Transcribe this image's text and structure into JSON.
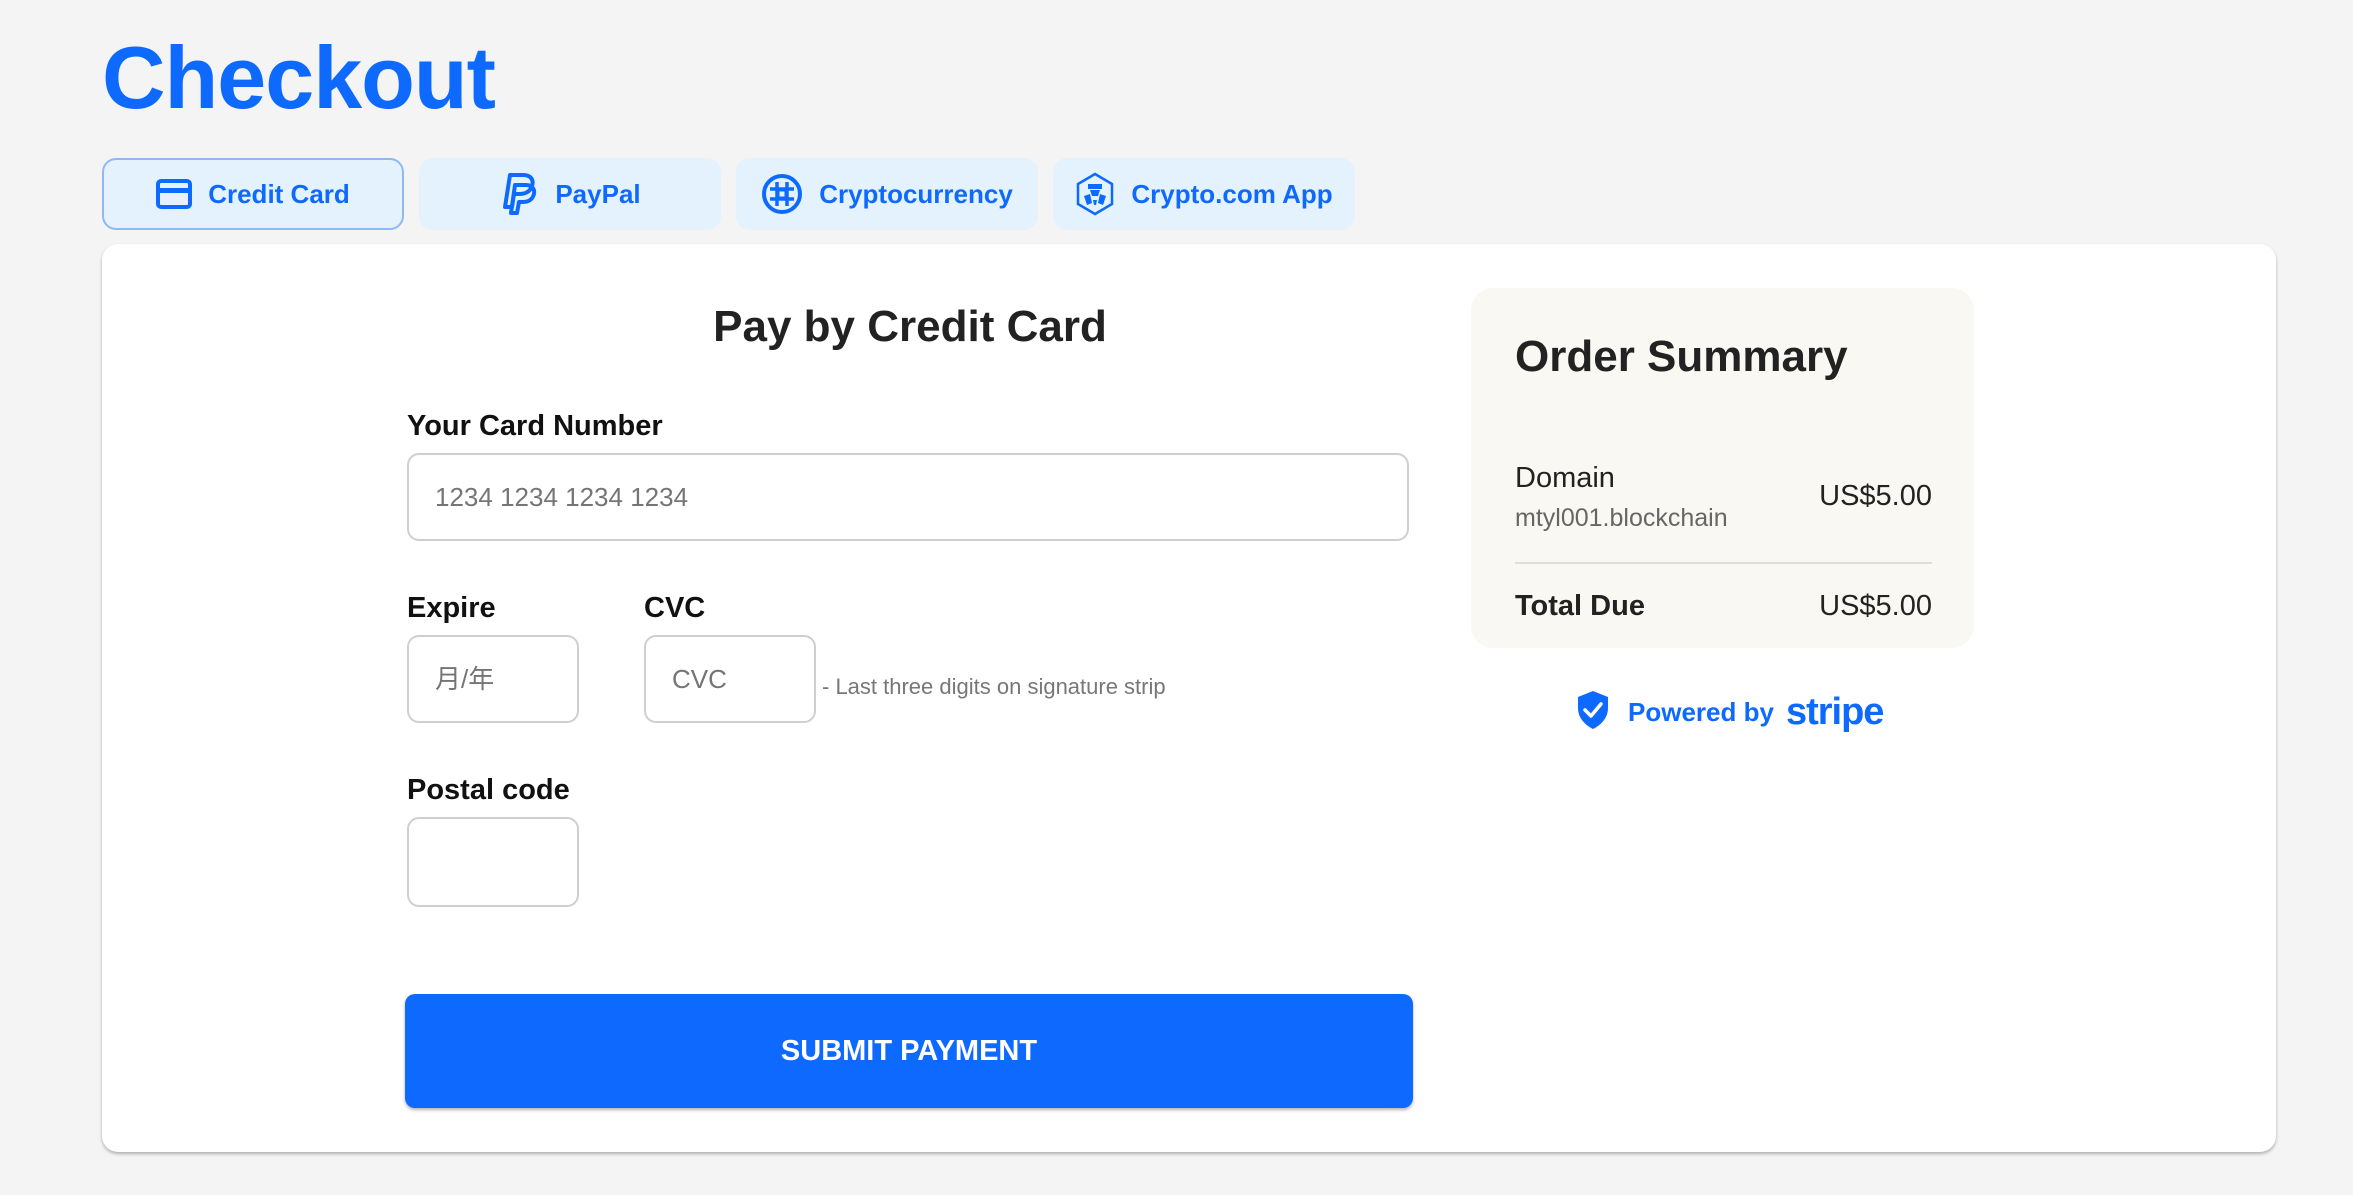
{
  "page": {
    "title": "Checkout",
    "accent_color": "#0e6aff"
  },
  "tabs": [
    {
      "label": "Credit Card",
      "icon": "credit-card-icon",
      "active": true
    },
    {
      "label": "PayPal",
      "icon": "paypal-icon",
      "active": false
    },
    {
      "label": "Cryptocurrency",
      "icon": "cryptocurrency-icon",
      "active": false
    },
    {
      "label": "Crypto.com App",
      "icon": "crypto-com-icon",
      "active": false
    }
  ],
  "form": {
    "title": "Pay by Credit Card",
    "card_number": {
      "label": "Your Card Number",
      "placeholder": "1234 1234 1234 1234",
      "value": ""
    },
    "expire": {
      "label": "Expire",
      "placeholder": "月/年",
      "value": ""
    },
    "cvc": {
      "label": "CVC",
      "placeholder": "CVC",
      "value": "",
      "hint": "- Last three digits on signature strip"
    },
    "postal_code": {
      "label": "Postal code",
      "placeholder": "",
      "value": ""
    },
    "submit_label": "SUBMIT PAYMENT"
  },
  "summary": {
    "title": "Order Summary",
    "item_name": "Domain",
    "item_detail": "mtyl001.blockchain",
    "item_price": "US$5.00",
    "total_label": "Total Due",
    "total_price": "US$5.00"
  },
  "footer": {
    "powered_by": "Powered by",
    "provider": "stripe",
    "icon": "shield-check-icon"
  }
}
